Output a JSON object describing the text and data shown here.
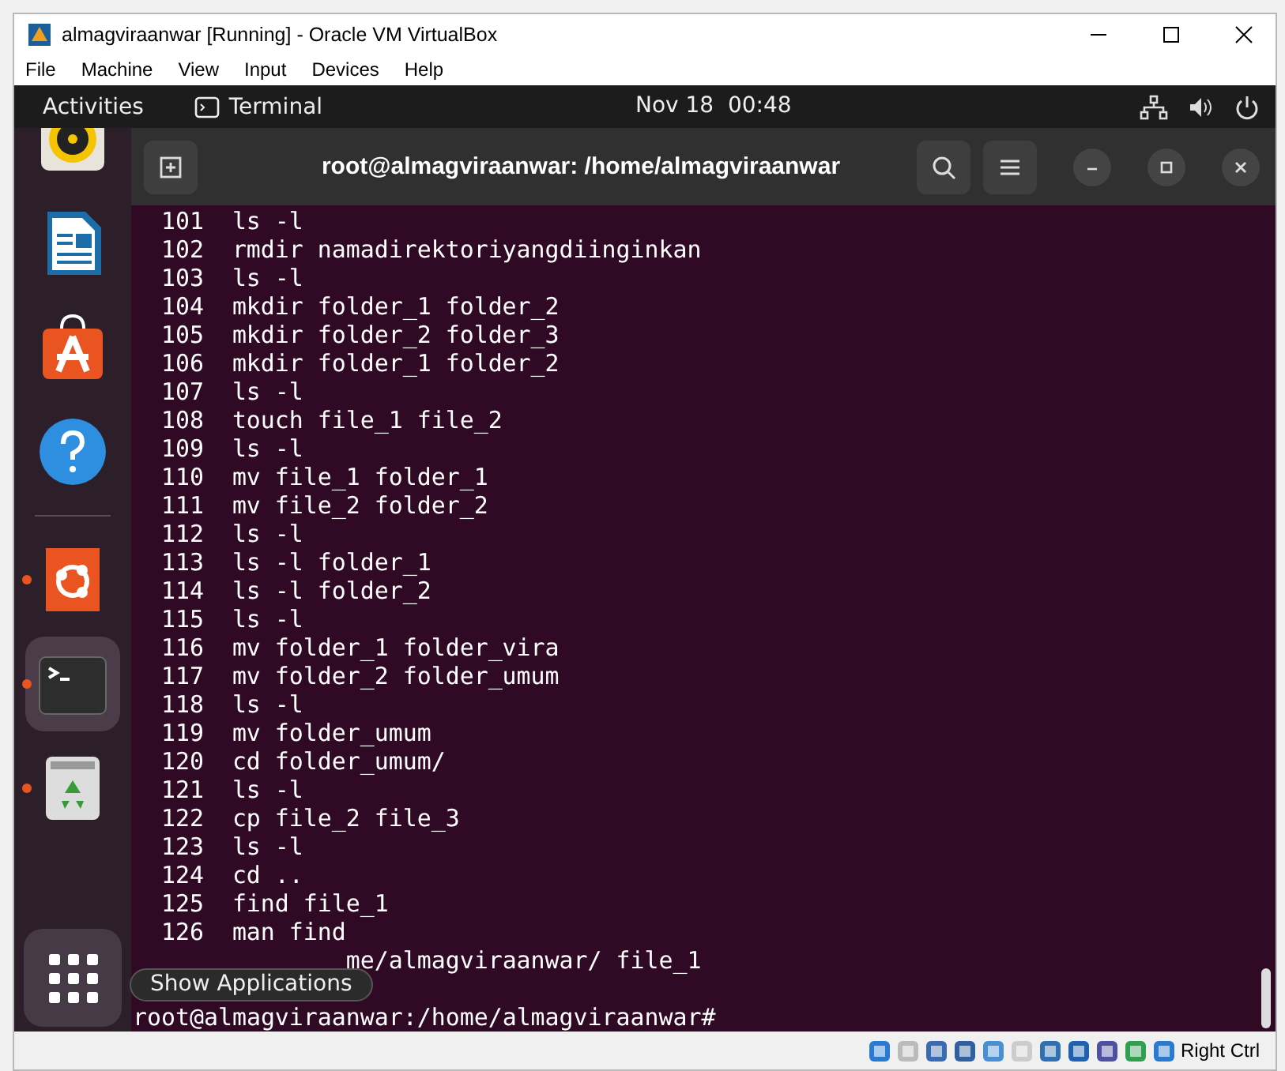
{
  "window": {
    "title": "almagviraanwar [Running] - Oracle VM VirtualBox"
  },
  "menu": [
    "File",
    "Machine",
    "View",
    "Input",
    "Devices",
    "Help"
  ],
  "top_bar": {
    "activities": "Activities",
    "app": "Terminal",
    "clock": "Nov 18  00:48"
  },
  "dock": {
    "items": [
      {
        "kind": "speaker",
        "running": false,
        "focused": false
      },
      {
        "kind": "document",
        "running": false,
        "focused": false
      },
      {
        "kind": "store",
        "running": false,
        "focused": false
      },
      {
        "kind": "help",
        "running": false,
        "focused": false
      },
      {
        "kind": "ubuntu",
        "running": true,
        "focused": false
      },
      {
        "kind": "terminal",
        "running": true,
        "focused": true
      },
      {
        "kind": "trash",
        "running": true,
        "focused": false
      }
    ],
    "tooltip": "Show Applications"
  },
  "terminal": {
    "title": "root@almagviraanwar: /home/almagviraanwar",
    "history": [
      {
        "number": "101",
        "command": "ls -l"
      },
      {
        "number": "102",
        "command": "rmdir namadirektoriyangdiinginkan"
      },
      {
        "number": "103",
        "command": "ls -l"
      },
      {
        "number": "104",
        "command": "mkdir folder_1 folder_2"
      },
      {
        "number": "105",
        "command": "mkdir folder_2 folder_3"
      },
      {
        "number": "106",
        "command": "mkdir folder_1 folder_2"
      },
      {
        "number": "107",
        "command": "ls -l"
      },
      {
        "number": "108",
        "command": "touch file_1 file_2"
      },
      {
        "number": "109",
        "command": "ls -l"
      },
      {
        "number": "110",
        "command": "mv file_1 folder_1"
      },
      {
        "number": "111",
        "command": "mv file_2 folder_2"
      },
      {
        "number": "112",
        "command": "ls -l"
      },
      {
        "number": "113",
        "command": "ls -l folder_1"
      },
      {
        "number": "114",
        "command": "ls -l folder_2"
      },
      {
        "number": "115",
        "command": "ls -l"
      },
      {
        "number": "116",
        "command": "mv folder_1 folder_vira"
      },
      {
        "number": "117",
        "command": "mv folder_2 folder_umum"
      },
      {
        "number": "118",
        "command": "ls -l"
      },
      {
        "number": "119",
        "command": "mv folder_umum"
      },
      {
        "number": "120",
        "command": "cd folder_umum/"
      },
      {
        "number": "121",
        "command": "ls -l"
      },
      {
        "number": "122",
        "command": "cp file_2 file_3"
      },
      {
        "number": "123",
        "command": "ls -l"
      },
      {
        "number": "124",
        "command": "cd .."
      },
      {
        "number": "125",
        "command": "find file_1"
      },
      {
        "number": "126",
        "command": "man find"
      }
    ],
    "partial_line": "me/almagviraanwar/ file_1",
    "prompt": "root@almagviraanwar:/home/almagviraanwar#"
  },
  "status_bar": {
    "host_key": "Right Ctrl"
  }
}
